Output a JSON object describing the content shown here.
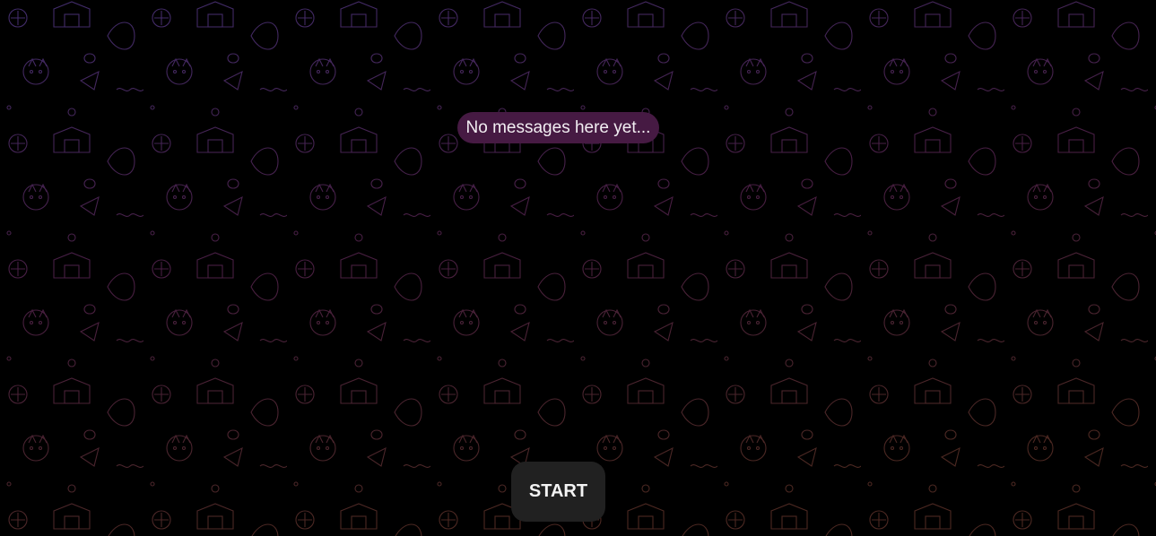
{
  "chat": {
    "empty_message": "No messages here yet...",
    "start_label": "START"
  },
  "colors": {
    "background": "#000000",
    "pattern_top": "#5a3a8a",
    "pattern_bottom": "#6a3a30",
    "empty_pill": "#461a43",
    "start_button": "#212121"
  }
}
